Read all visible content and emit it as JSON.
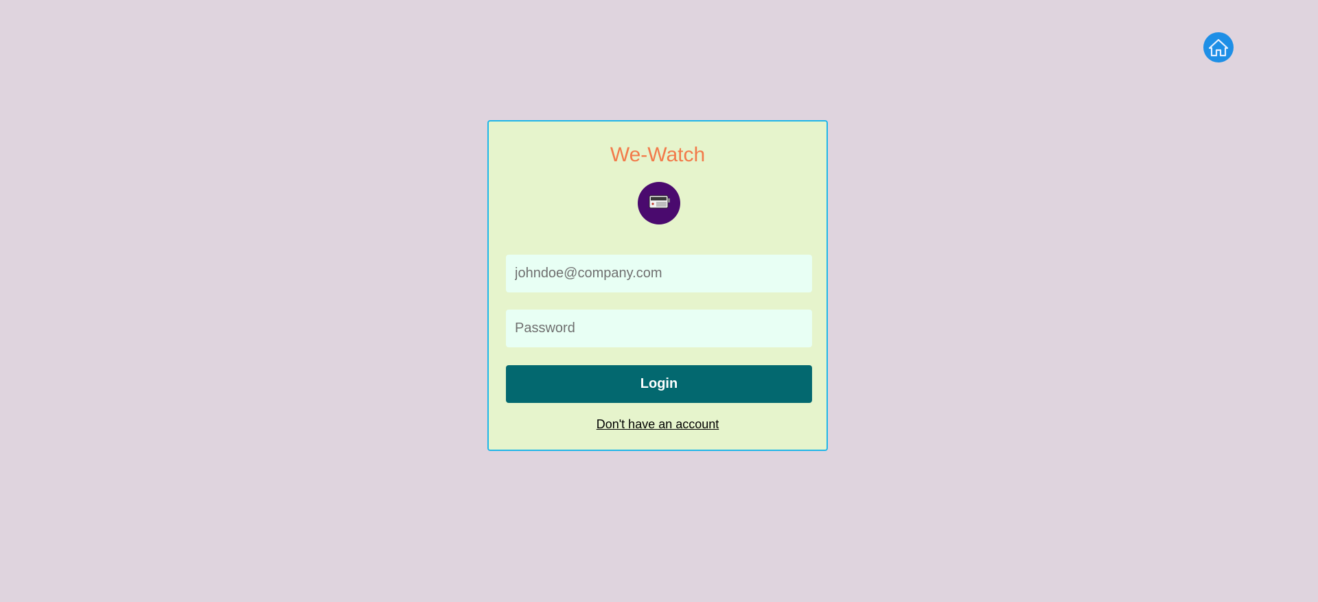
{
  "header": {
    "home_icon": "home-icon",
    "home_color": "#1e8fe6"
  },
  "login_card": {
    "title": "We-Watch",
    "title_color": "#f27a4a",
    "logo_icon": "projector-icon",
    "logo_color": "#4a0a6e",
    "email": {
      "value": "",
      "placeholder": "johndoe@company.com"
    },
    "password": {
      "value": "",
      "placeholder": "Password"
    },
    "login_label": "Login",
    "login_color": "#03686f",
    "signup_link": "Don't have an account"
  }
}
